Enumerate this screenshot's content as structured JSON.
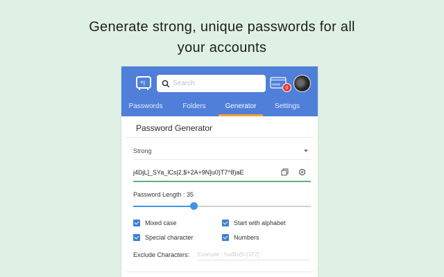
{
  "headline": {
    "line1": "Generate strong, unique passwords for all",
    "line2": "your accounts"
  },
  "header": {
    "logo_icon": "vault-logo-icon",
    "search_placeholder": "Search",
    "www_badge_count": "0",
    "accent": "#4f7fd8"
  },
  "tabs": [
    {
      "label": "Passwords"
    },
    {
      "label": "Folders"
    },
    {
      "label": "Generator",
      "active": true
    },
    {
      "label": "Settings"
    }
  ],
  "generator": {
    "title": "Password Generator",
    "strength": "Strong",
    "password": "j4DjL]_SYa_lCs|2,$+2A+9N]u0)T7^8)aE",
    "length_label": "Password Length : 35",
    "length_value": 35,
    "length_fraction": 0.34,
    "options": {
      "mixed_case": "Mixed case",
      "start_alpha": "Start with alphabet",
      "special": "Special character",
      "numbers": "Numbers"
    },
    "exclude_label": "Exclude Characters:",
    "exclude_placeholder": "Example : %a$b@c[1F2]"
  }
}
